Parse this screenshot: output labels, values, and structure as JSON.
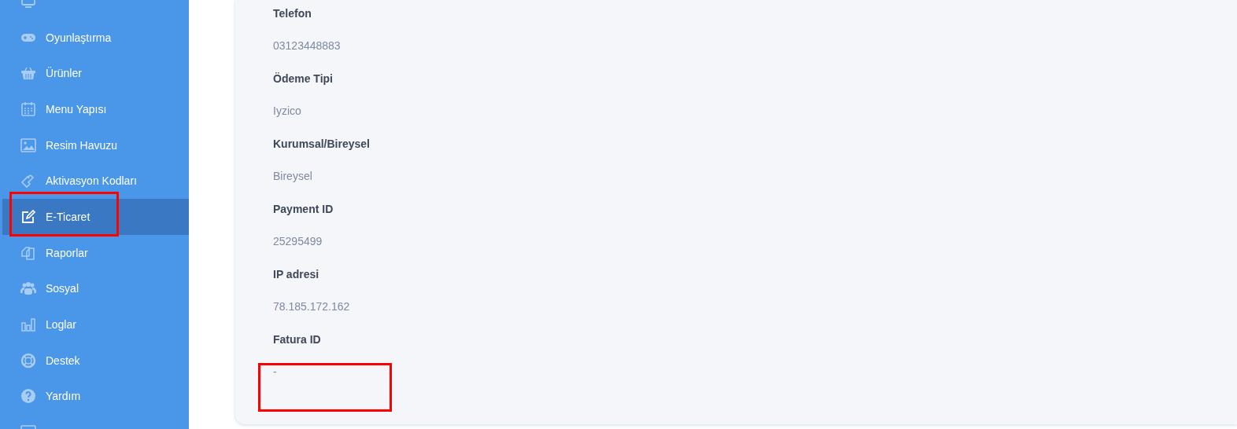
{
  "sidebar": {
    "items": [
      {
        "label": "Oyunlaştırma",
        "selected": false,
        "highlighted": false
      },
      {
        "label": "Ürünler",
        "selected": false,
        "highlighted": false
      },
      {
        "label": "Menu Yapısı",
        "selected": false,
        "highlighted": false
      },
      {
        "label": "Resim Havuzu",
        "selected": false,
        "highlighted": false
      },
      {
        "label": "Aktivasyon Kodları",
        "selected": false,
        "highlighted": false
      },
      {
        "label": "E-Ticaret",
        "selected": true,
        "highlighted": true
      },
      {
        "label": "Raporlar",
        "selected": false,
        "highlighted": false
      },
      {
        "label": "Sosyal",
        "selected": false,
        "highlighted": false
      },
      {
        "label": "Loglar",
        "selected": false,
        "highlighted": false
      },
      {
        "label": "Destek",
        "selected": false,
        "highlighted": false
      },
      {
        "label": "Yardım",
        "selected": false,
        "highlighted": false
      }
    ]
  },
  "details": {
    "fields": [
      {
        "label": "Telefon",
        "value": "03123448883",
        "highlighted": false
      },
      {
        "label": "Ödeme Tipi",
        "value": "Iyzico",
        "highlighted": false
      },
      {
        "label": "Kurumsal/Bireysel",
        "value": "Bireysel",
        "highlighted": false
      },
      {
        "label": "Payment ID",
        "value": "25295499",
        "highlighted": false
      },
      {
        "label": "IP adresi",
        "value": "78.185.172.162",
        "highlighted": false
      },
      {
        "label": "Fatura ID",
        "value": "-",
        "highlighted": true
      }
    ]
  }
}
